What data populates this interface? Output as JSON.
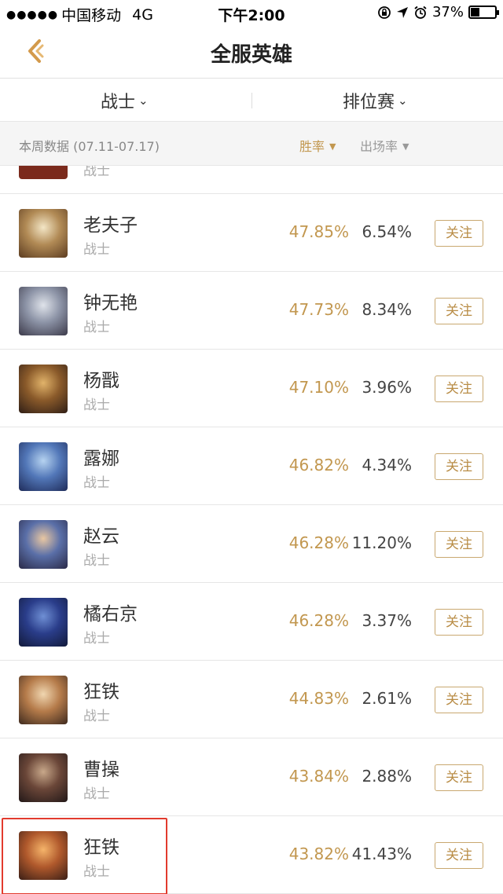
{
  "status_bar": {
    "signal": "●●●●●",
    "carrier": "中国移动",
    "network": "4G",
    "time": "下午2:00",
    "battery": "37%",
    "battery_level": 0.37
  },
  "nav": {
    "title": "全服英雄"
  },
  "filters": {
    "role": "战士",
    "mode": "排位赛"
  },
  "sort_bar": {
    "week_label": "本周数据 (07.11-07.17)",
    "win_rate_label": "胜率",
    "pick_rate_label": "出场率"
  },
  "partial_row": {
    "role": "战士",
    "avatar_color": "#7b2a1c"
  },
  "heroes": [
    {
      "name": "老夫子",
      "role": "战士",
      "win_rate": "47.85%",
      "pick_rate": "6.54%",
      "follow": "关注",
      "avatar_colors": [
        "#f3e6c6",
        "#b18a55",
        "#5c3c20"
      ]
    },
    {
      "name": "钟无艳",
      "role": "战士",
      "win_rate": "47.73%",
      "pick_rate": "8.34%",
      "follow": "关注",
      "avatar_colors": [
        "#dfe3ea",
        "#8c93a6",
        "#3c3a4a"
      ]
    },
    {
      "name": "杨戬",
      "role": "战士",
      "win_rate": "47.10%",
      "pick_rate": "3.96%",
      "follow": "关注",
      "avatar_colors": [
        "#e1b36a",
        "#8a5a2a",
        "#2f1e16"
      ]
    },
    {
      "name": "露娜",
      "role": "战士",
      "win_rate": "46.82%",
      "pick_rate": "4.34%",
      "follow": "关注",
      "avatar_colors": [
        "#b6d3f0",
        "#5277b8",
        "#1f2c5a"
      ]
    },
    {
      "name": "赵云",
      "role": "战士",
      "win_rate": "46.28%",
      "pick_rate": "11.20%",
      "follow": "关注",
      "avatar_colors": [
        "#e9c7a2",
        "#5a6fa8",
        "#2a2a48"
      ]
    },
    {
      "name": "橘右京",
      "role": "战士",
      "win_rate": "46.28%",
      "pick_rate": "3.37%",
      "follow": "关注",
      "avatar_colors": [
        "#6f8fd4",
        "#2a3d8a",
        "#121a3a"
      ]
    },
    {
      "name": "狂铁",
      "role": "战士",
      "win_rate": "44.83%",
      "pick_rate": "2.61%",
      "follow": "关注",
      "avatar_colors": [
        "#f0d6b0",
        "#b57b4a",
        "#3e2a1e"
      ]
    },
    {
      "name": "曹操",
      "role": "战士",
      "win_rate": "43.84%",
      "pick_rate": "2.88%",
      "follow": "关注",
      "avatar_colors": [
        "#c8a88a",
        "#6a4638",
        "#221818"
      ]
    },
    {
      "name": "狂铁",
      "role": "战士",
      "win_rate": "43.82%",
      "pick_rate": "41.43%",
      "follow": "关注",
      "avatar_colors": [
        "#f5b46a",
        "#b0592c",
        "#3a1e16"
      ]
    }
  ],
  "colors": {
    "accent_gold": "#c2974f",
    "highlight_red": "#e23b2e"
  }
}
